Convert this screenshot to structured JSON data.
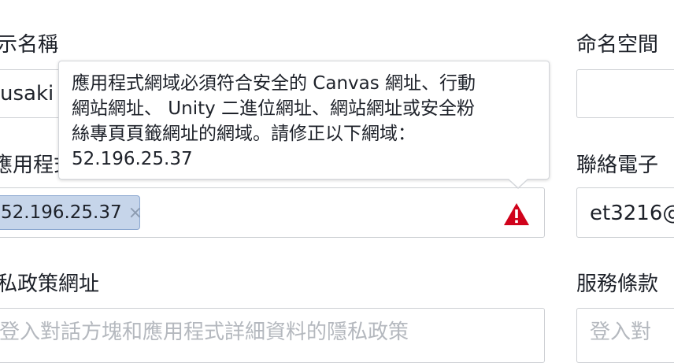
{
  "left": {
    "display_name_label": "示名稱",
    "display_name_value": "usaki",
    "app_domain_label": "應用程式",
    "app_domain_tag": "52.196.25.37",
    "tag_remove_symbol": "×",
    "privacy_label": "私政策網址",
    "privacy_placeholder": "登入對話方塊和應用程式詳細資料的隱私政策"
  },
  "right": {
    "namespace_label": "命名空間",
    "contact_email_label": "聯絡電子",
    "contact_email_value": "et3216@",
    "terms_label": "服務條款",
    "terms_placeholder": "登入對"
  },
  "tooltip": {
    "lines": [
      "應用程式網域必須符合安全的 Canvas 網址、行動",
      "網站網址、 Unity 二進位網址、網站網址或安全粉",
      "絲專頁頁籤網址的網域。請修正以下網域：",
      "52.196.25.37"
    ]
  },
  "colors": {
    "warning": "#d0021b",
    "tag_bg": "#c6d5ea"
  },
  "icons": {
    "warning": "warning-triangle-icon",
    "remove": "close-icon"
  }
}
